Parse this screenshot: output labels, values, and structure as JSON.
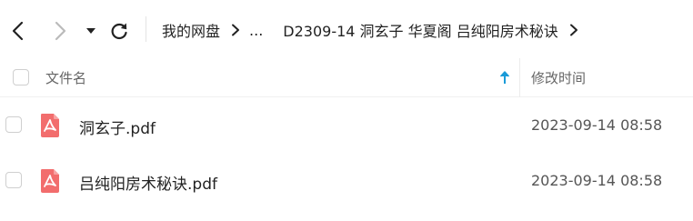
{
  "toolbar": {
    "back_icon": "chevron-left-icon",
    "forward_icon": "chevron-right-icon",
    "dropdown_icon": "caret-down-icon",
    "refresh_icon": "refresh-icon"
  },
  "breadcrumb": {
    "root": "我的网盘",
    "ellipsis": "...",
    "current": "D2309-14 洞玄子 华夏阁 吕纯阳房术秘诀"
  },
  "table": {
    "col_name": "文件名",
    "col_time": "修改时间",
    "sort_icon": "arrow-up-icon",
    "accent_color": "#1a9bd8",
    "rows": [
      {
        "name": "洞玄子.pdf",
        "time": "2023-09-14 08:58",
        "icon": "pdf-icon"
      },
      {
        "name": "吕纯阳房术秘诀.pdf",
        "time": "2023-09-14 08:58",
        "icon": "pdf-icon"
      }
    ]
  },
  "colors": {
    "pdf_icon": "#f26d6d",
    "text_primary": "#222222",
    "text_secondary": "#666666"
  }
}
